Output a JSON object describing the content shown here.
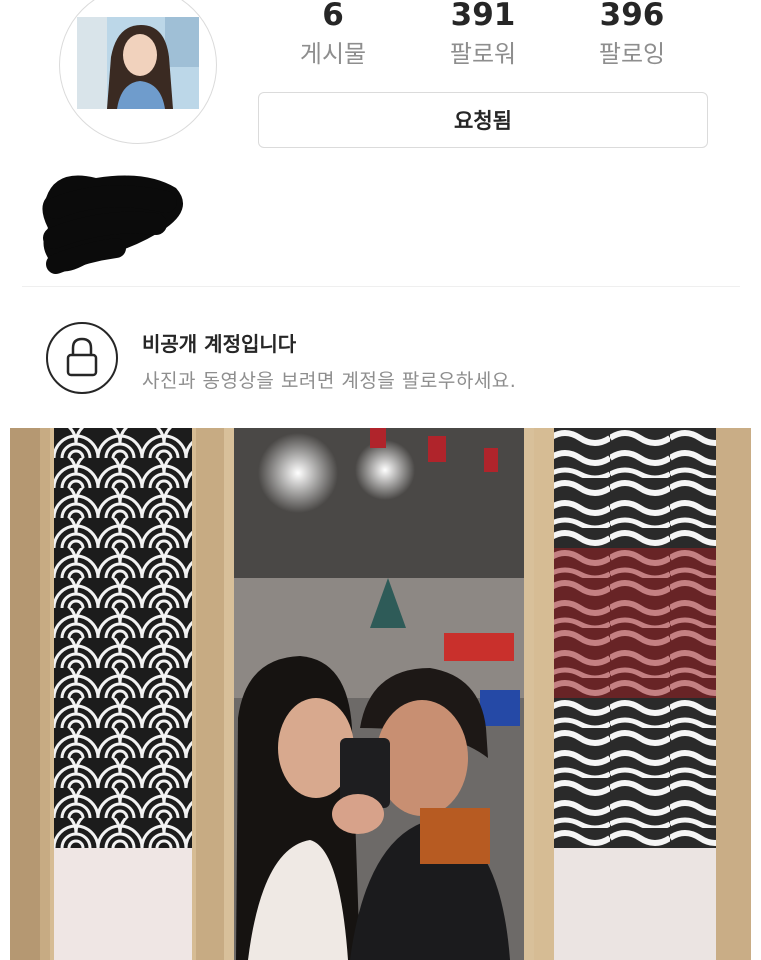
{
  "profile": {
    "stats": [
      {
        "count": "6",
        "label": "게시물"
      },
      {
        "count": "391",
        "label": "팔로워"
      },
      {
        "count": "396",
        "label": "팔로잉"
      }
    ],
    "follow_button_label": "요청됨"
  },
  "private_notice": {
    "title": "비공개 계정입니다",
    "description": "사진과 동영상을 보려면 계정을 팔로우하세요.",
    "icon": "lock-icon"
  },
  "colors": {
    "text_primary": "#262626",
    "text_secondary": "#8e8e8e",
    "border": "#dbdbdb"
  }
}
